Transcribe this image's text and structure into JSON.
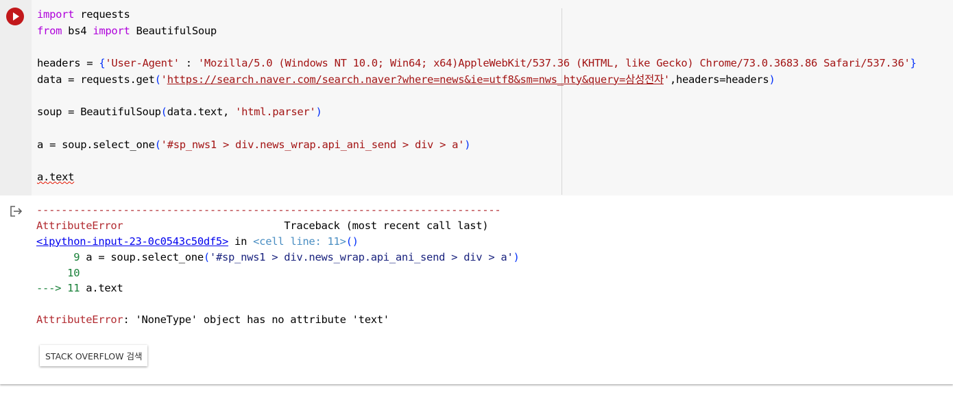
{
  "cell": {
    "code_lines": [
      {
        "p1": "import",
        "p2": " requests"
      },
      {
        "p1": "from",
        "p2": " bs4 ",
        "p3": "import",
        "p4": " BeautifulSoup"
      },
      {},
      {
        "p1": "headers = ",
        "p2": "{",
        "p3": "'User-Agent'",
        "p4": " : ",
        "p5": "'Mozilla/5.0 (Windows NT 10.0; Win64; x64)AppleWebKit/537.36 (KHTML, like Gecko) Chrome/73.0.3683.86 Safari/537.36'",
        "p6": "}"
      },
      {
        "p1": "data = requests.get",
        "p2": "(",
        "p3": "'",
        "p4": "https://search.naver.com/search.naver?where=news&ie=utf8&sm=nws_hty&query=삼성전자",
        "p5": "'",
        "p6": ",headers=headers",
        "p7": ")"
      },
      {},
      {
        "p1": "soup = BeautifulSoup",
        "p2": "(",
        "p3": "data.text, ",
        "p4": "'html.parser'",
        "p5": ")"
      },
      {},
      {
        "p1": "a = soup.select_one",
        "p2": "(",
        "p3": "'#sp_nws1 > div.news_wrap.api_ani_send > div > a'",
        "p4": ")"
      },
      {},
      {
        "p1": "a.text"
      }
    ]
  },
  "output": {
    "separator": "---------------------------------------------------------------------------",
    "error_name": "AttributeError",
    "traceback_header": "                          Traceback (most recent call last)",
    "input_link": "<ipython-input-23-0c0543c50df5>",
    "in_text": " in ",
    "cell_line": "<cell line: 11>",
    "parens": "()",
    "line9_num": "      9",
    "line9_code_a": " a = soup.select_one",
    "line9_paren_open": "(",
    "line9_str": "'#sp_nws1 > div.news_wrap.api_ani_send > div > a'",
    "line9_paren_close": ")",
    "line10_num": "     10",
    "arrow": "--->",
    "line11_num": " 11",
    "line11_code": " a.text",
    "final_error_name": "AttributeError",
    "final_error_msg": ": 'NoneType' object has no attribute 'text'"
  },
  "stackoverflow_button": "STACK OVERFLOW 검색",
  "colors": {
    "run_button": "#c2181b",
    "keyword": "#af00db",
    "string": "#a31515",
    "bracket": "#0431fa",
    "error_red": "#b22b31"
  },
  "icons": {
    "run": "play-circle-icon",
    "output": "output-redirect-icon"
  }
}
